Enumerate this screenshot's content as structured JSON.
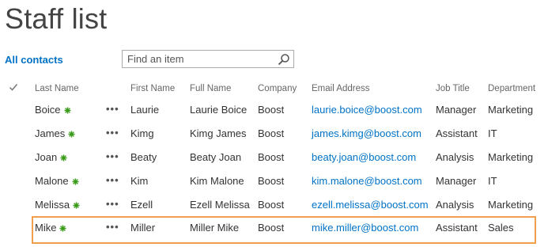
{
  "page": {
    "title": "Staff list",
    "view_label": "All contacts",
    "search_placeholder": "Find an item",
    "ellipsis": "•••"
  },
  "columns": {
    "last_name": "Last Name",
    "first_name": "First Name",
    "full_name": "Full Name",
    "company": "Company",
    "email": "Email Address",
    "job_title": "Job Title",
    "department": "Department"
  },
  "rows": [
    {
      "last_name": "Boice",
      "first_name": "Laurie",
      "full_name": "Laurie Boice",
      "company": "Boost",
      "email": "laurie.boice@boost.com",
      "job_title": "Manager",
      "department": "Marketing",
      "selected": false
    },
    {
      "last_name": "James",
      "first_name": "Kimg",
      "full_name": "Kimg James",
      "company": "Boost",
      "email": "james.kimg@boost.com",
      "job_title": "Assistant",
      "department": "IT",
      "selected": false
    },
    {
      "last_name": "Joan",
      "first_name": "Beaty",
      "full_name": "Beaty Joan",
      "company": "Boost",
      "email": "beaty.joan@boost.com",
      "job_title": "Analysis",
      "department": "Marketing",
      "selected": false
    },
    {
      "last_name": "Malone",
      "first_name": "Kim",
      "full_name": "Kim Malone",
      "company": "Boost",
      "email": "kim.malone@boost.com",
      "job_title": "Manager",
      "department": "IT",
      "selected": false
    },
    {
      "last_name": "Melissa",
      "first_name": "Ezell",
      "full_name": "Ezell Melissa",
      "company": "Boost",
      "email": "ezell.melissa@boost.com",
      "job_title": "Analysis",
      "department": "Marketing",
      "selected": false
    },
    {
      "last_name": "Mike",
      "first_name": "Miller",
      "full_name": "Miller Mike",
      "company": "Boost",
      "email": "mike.miller@boost.com",
      "job_title": "Assistant",
      "department": "Sales",
      "selected": true
    }
  ],
  "colors": {
    "link": "#0072c6",
    "selection_border": "#f29f4d",
    "new_icon": "#3a9a1a"
  }
}
